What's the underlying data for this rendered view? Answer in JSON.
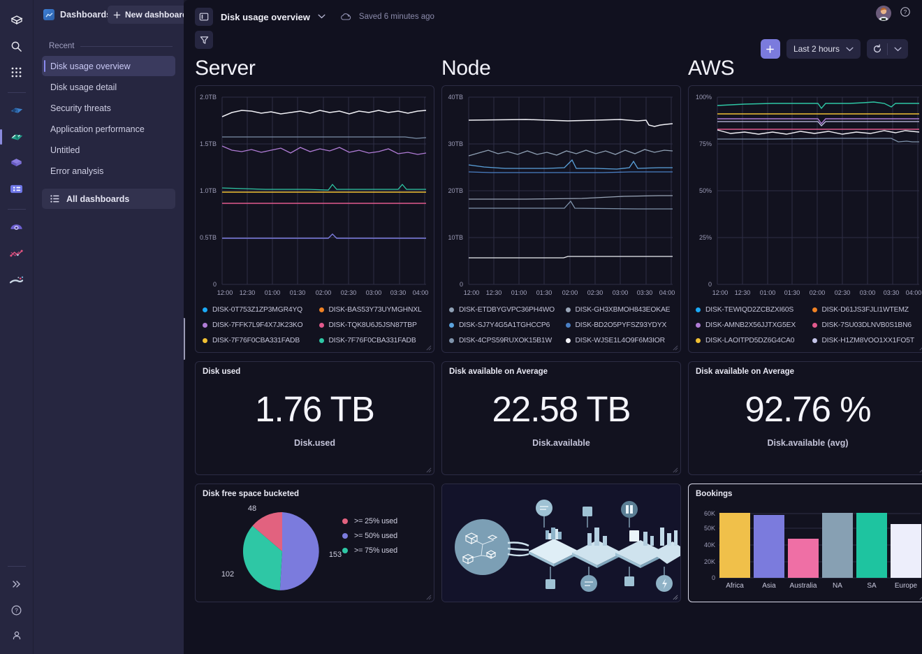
{
  "app": {
    "brand_icon": "cube-logo-icon",
    "header": {
      "dashboards_label": "Dashboards",
      "new_dashboard_label": "New dashboard"
    },
    "rail_icons": [
      {
        "name": "cube-logo-icon"
      },
      {
        "name": "search-icon"
      },
      {
        "name": "app-grid-icon"
      },
      {
        "name": "discover-icon"
      },
      {
        "name": "dashboards-icon"
      },
      {
        "name": "canvas-icon"
      },
      {
        "name": "content-icon"
      },
      {
        "name": "observability-icon"
      },
      {
        "name": "apm-icon"
      },
      {
        "name": "ml-icon"
      }
    ],
    "rail_bottom_icons": [
      {
        "name": "expand-icon"
      },
      {
        "name": "help-icon"
      },
      {
        "name": "account-icon"
      }
    ],
    "avatar_alt": "user-avatar",
    "help_label": "?"
  },
  "sidebar": {
    "section_label": "Recent",
    "items": [
      {
        "label": "Disk usage overview",
        "active": true
      },
      {
        "label": "Disk usage detail",
        "active": false
      },
      {
        "label": "Security threats",
        "active": false
      },
      {
        "label": "Application performance",
        "active": false
      },
      {
        "label": "Untitled",
        "active": false
      },
      {
        "label": "Error analysis",
        "active": false
      }
    ],
    "all_dashboards_label": "All dashboards"
  },
  "toolbar": {
    "dashboard_title": "Disk usage overview",
    "saved_text": "Saved 6 minutes ago",
    "time_range": "Last 2 hours",
    "add_label": "+",
    "panel_toggle_icon": "sidebar-toggle-icon",
    "filter_icon": "filter-icon",
    "refresh_icon": "refresh-icon",
    "cloud_icon": "cloud-saved-icon"
  },
  "sections": [
    {
      "title": "Server"
    },
    {
      "title": "Node"
    },
    {
      "title": "AWS"
    }
  ],
  "chart_data": [
    {
      "id": "server-timeseries",
      "type": "line",
      "title": "Server",
      "xlabel": "",
      "ylabel": "",
      "ylim": [
        0,
        2.0
      ],
      "ytick_labels": [
        "2.0TB",
        "1.5TB",
        "1.0TB",
        "0.5TB",
        "0"
      ],
      "xtick_labels": [
        "12:00",
        "12:30",
        "01:00",
        "01:30",
        "02:00",
        "02:30",
        "03:00",
        "03:30",
        "04:00"
      ],
      "grid": true,
      "legend_position": "bottom",
      "series": [
        {
          "name": "DISK-0T753Z1ZP3MGR4YQ",
          "color": "#1ba9f5",
          "level": 0.54
        },
        {
          "name": "DISK-BAS53Y73UYMGHNXL",
          "color": "#f08224",
          "level": 0.99
        },
        {
          "name": "DISK-7FFK7L9F4X7JK23KO",
          "color": "#b07cd6",
          "level": 1.46
        },
        {
          "name": "DISK-TQK8U6J5JSN87TBP",
          "color": "#e25a8d",
          "level": 0.88
        },
        {
          "name": "DISK-7F76F0CBA331FADB",
          "color": "#f0c033",
          "level": 1.0
        },
        {
          "name": "DISK-7F76F0CBA331FADB",
          "color": "#2ec7a5",
          "level": 1.03
        }
      ],
      "extra_series": [
        {
          "name": "white-top",
          "color": "#f2f2f7",
          "level": 1.79
        },
        {
          "name": "grey-mid",
          "color": "#7b8fa8",
          "level": 1.57
        }
      ]
    },
    {
      "id": "node-timeseries",
      "type": "line",
      "title": "Node",
      "xlabel": "",
      "ylabel": "",
      "ylim": [
        0,
        40
      ],
      "ytick_labels": [
        "40TB",
        "30TB",
        "20TB",
        "10TB",
        "0"
      ],
      "xtick_labels": [
        "12:00",
        "12:30",
        "01:00",
        "01:30",
        "02:00",
        "02:30",
        "03:00",
        "03:30",
        "04:00"
      ],
      "grid": true,
      "legend_position": "bottom",
      "series": [
        {
          "name": "DISK-ETDBYGVPC36PH4WO",
          "color": "#8fa0b4",
          "level": 26.5
        },
        {
          "name": "DISK-GH3XBMOH843EOKAE",
          "color": "#9aa6b8",
          "level": 18.8
        },
        {
          "name": "DISK-SJ7Y4G5A1TGHCCP6",
          "color": "#5ba3dd",
          "level": 22.3
        },
        {
          "name": "DISK-BD2O5PYFSZ93YDYX",
          "color": "#4a7fc4",
          "level": 21.2
        },
        {
          "name": "DISK-4CPS59RUXOK15B1W",
          "color": "#7f93ab",
          "level": 15.9
        },
        {
          "name": "DISK-WJSE1L4O9F6M3IOR",
          "color": "#f2f2f7",
          "level": 35.2
        }
      ],
      "extra_series": [
        {
          "name": "white-low",
          "color": "#eceef2",
          "level": 5.3
        }
      ]
    },
    {
      "id": "aws-timeseries",
      "type": "line",
      "title": "AWS",
      "xlabel": "",
      "ylabel": "",
      "ylim": [
        0,
        100
      ],
      "ytick_labels": [
        "100%",
        "75%",
        "50%",
        "25%",
        "0"
      ],
      "xtick_labels": [
        "12:00",
        "12:30",
        "01:00",
        "01:30",
        "02:00",
        "02:30",
        "03:00",
        "03:30",
        "04:00"
      ],
      "grid": true,
      "legend_position": "bottom",
      "series": [
        {
          "name": "DISK-TEWIQD2ZCBZXI60S",
          "color": "#1ba9f5",
          "level": 88.0
        },
        {
          "name": "DISK-D61JS3FJLI1WTEMZ",
          "color": "#f08224",
          "level": 86.5
        },
        {
          "name": "DISK-AMNB2X56JJTXG5EX",
          "color": "#b07cd6",
          "level": 87.5
        },
        {
          "name": "DISK-7SU03DLNVB0S1BN6",
          "color": "#e25a8d",
          "level": 82.0
        },
        {
          "name": "DISK-LAOITPD5DZ6G4CA0",
          "color": "#f0c033",
          "level": 90.5
        },
        {
          "name": "DISK-H1ZM8VOO1XX1FO5T",
          "color": "#c4c4e8",
          "level": 83.5
        }
      ],
      "extra_series": [
        {
          "name": "teal-top",
          "color": "#2ec7a5",
          "level": 95.5
        },
        {
          "name": "grey-bot",
          "color": "#7f93ab",
          "level": 78.0
        },
        {
          "name": "white-mid",
          "color": "#f0f0f5",
          "level": 81.0
        }
      ]
    },
    {
      "id": "disk-free-space-pie",
      "type": "pie",
      "title": "Disk free space bucketed",
      "labels": [
        ">= 25% used",
        ">= 50% used",
        ">= 75% used"
      ],
      "values": [
        48,
        153,
        102
      ],
      "colors": [
        "#e2627f",
        "#7b7bdd",
        "#2ec7a5"
      ],
      "legend_position": "right"
    },
    {
      "id": "bookings-bar",
      "type": "bar",
      "title": "Bookings",
      "categories": [
        "Africa",
        "Asia",
        "Australia",
        "NA",
        "SA",
        "Europe"
      ],
      "values": [
        63000,
        61000,
        46000,
        63000,
        63500,
        55000
      ],
      "colors": [
        "#f0c04a",
        "#7b7bdd",
        "#ef6fa5",
        "#87a0b3",
        "#1ec4a0",
        "#edeefb"
      ],
      "ytick_labels": [
        "60K",
        "50K",
        "40K",
        "20K",
        "0"
      ],
      "ylim": [
        0,
        65000
      ],
      "xlabel": "",
      "ylabel": "",
      "grid": true,
      "legend_position": "none"
    }
  ],
  "stat_panels": [
    {
      "title": "Disk used",
      "value": "1.76 TB",
      "subtitle": "Disk.used"
    },
    {
      "title": "Disk available on Average",
      "value": "22.58 TB",
      "subtitle": "Disk.available"
    },
    {
      "title": "Disk available on Average",
      "value": "92.76 %",
      "subtitle": "Disk.available (avg)"
    }
  ],
  "image_panel": {
    "alt": "isometric-network-illustration"
  }
}
